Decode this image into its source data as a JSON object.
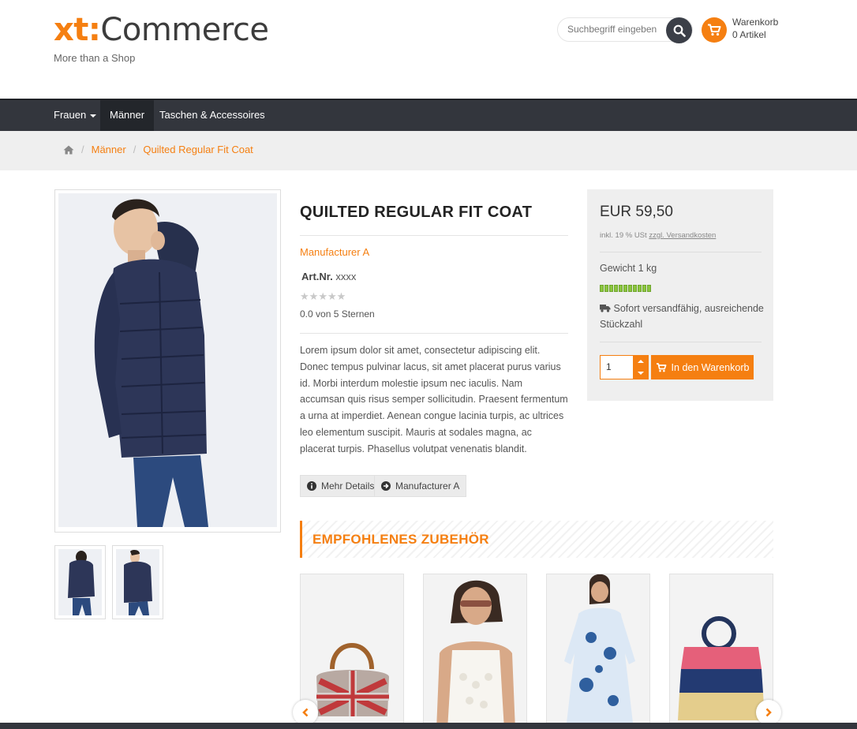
{
  "header": {
    "logo_prefix": "xt:",
    "logo_name": "Commerce",
    "tagline": "More than a Shop",
    "search_placeholder": "Suchbegriff eingeben",
    "cart_label": "Warenkorb",
    "cart_count": "0 Artikel"
  },
  "nav": {
    "items": [
      {
        "label": "Frauen",
        "has_dropdown": true
      },
      {
        "label": "Männer",
        "active": true
      },
      {
        "label": "Taschen & Accessoires"
      }
    ]
  },
  "breadcrumb": {
    "items": [
      "Männer",
      "Quilted Regular Fit Coat"
    ]
  },
  "product": {
    "title": "QUILTED REGULAR FIT COAT",
    "manufacturer": "Manufacturer A",
    "artnr_label": "Art.Nr.",
    "artnr_value": "xxxx",
    "rating": 0,
    "rating_text": "0.0 von 5 Sternen",
    "description": "Lorem ipsum dolor sit amet, consectetur adipiscing elit. Donec tempus pulvinar lacus, sit amet placerat purus varius id. Morbi interdum molestie ipsum nec iaculis. Nam accumsan quis risus semper sollicitudin. Praesent fermentum a urna at imperdiet. Aenean congue lacinia turpis, ac ultrices leo elementum suscipit. Mauris at sodales magna, ac placerat turpis. Phasellus volutpat venenatis blandit.",
    "more_details": "Mehr Details",
    "manufacturer_button": "Manufacturer A"
  },
  "pricebox": {
    "price": "EUR 59,50",
    "vat_prefix": "inkl. 19 % USt",
    "shipping_link": "zzgl. Versandkosten",
    "weight": "Gewicht 1 kg",
    "stock_level": 1.0,
    "shipping_status": "Sofort versandfähig, ausreichende Stückzahl",
    "quantity": "1",
    "add_to_cart": "In den Warenkorb"
  },
  "accessories": {
    "heading": "EMPFOHLENES ZUBEHÖR"
  },
  "colors": {
    "accent": "#f57f11",
    "nav_bg": "#33363d",
    "stock_green": "#8cc63f"
  }
}
